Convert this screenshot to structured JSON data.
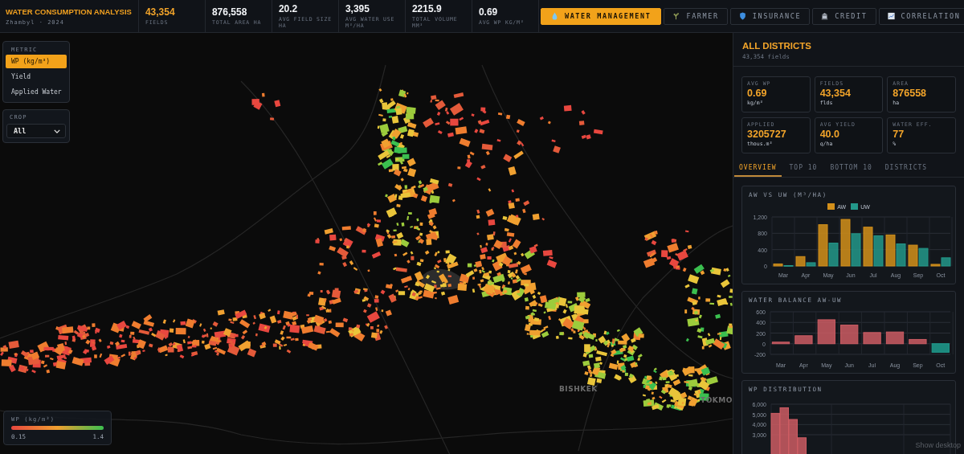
{
  "header": {
    "title": "WATER CONSUMPTION ANALYSIS",
    "subtitle": "Zhambyl · 2024",
    "stats": [
      {
        "value": "43,354",
        "label": "FIELDS",
        "highlight": true
      },
      {
        "value": "876,558",
        "label": "TOTAL AREA HA",
        "highlight": false
      },
      {
        "value": "20.2",
        "label": "AVG FIELD SIZE HA",
        "highlight": false
      },
      {
        "value": "3,395",
        "label": "AVG WATER USE M³/HA",
        "highlight": false
      },
      {
        "value": "2215.9",
        "label": "TOTAL VOLUME MM³",
        "highlight": false
      },
      {
        "value": "0.69",
        "label": "AVG WP KG/M³",
        "highlight": false
      }
    ]
  },
  "nav_tabs": [
    {
      "label": "WATER MANAGEMENT",
      "selected": true
    },
    {
      "label": "FARMER",
      "selected": false
    },
    {
      "label": "INSURANCE",
      "selected": false
    },
    {
      "label": "CREDIT",
      "selected": false
    },
    {
      "label": "CORRELATION",
      "selected": false
    }
  ],
  "map": {
    "metric": {
      "title": "METRIC",
      "options": [
        {
          "label": "WP (kg/m³)",
          "selected": true
        },
        {
          "label": "Yield",
          "selected": false
        },
        {
          "label": "Applied Water",
          "selected": false
        }
      ]
    },
    "crop": {
      "title": "CROP",
      "value": "All"
    },
    "legend": {
      "title": "WP (kg/m³)",
      "min": "0.15",
      "max": "1.4"
    },
    "place_labels": [
      {
        "name": "BISHKEK"
      },
      {
        "name": "TOKMO"
      }
    ]
  },
  "panel": {
    "title": "ALL DISTRICTS",
    "subtitle": "43,354 fields",
    "cards": [
      {
        "label": "AVG WP",
        "value": "0.69",
        "unit": "kg/m³"
      },
      {
        "label": "FIELDS",
        "value": "43,354",
        "unit": "flds"
      },
      {
        "label": "AREA",
        "value": "876558",
        "unit": "ha"
      },
      {
        "label": "APPLIED",
        "value": "3205727",
        "unit": "thous.m³"
      },
      {
        "label": "AVG YIELD",
        "value": "40.0",
        "unit": "q/ha"
      },
      {
        "label": "WATER EFF.",
        "value": "77",
        "unit": "%"
      }
    ],
    "tabs": [
      {
        "label": "OVERVIEW",
        "selected": true
      },
      {
        "label": "TOP 10",
        "selected": false
      },
      {
        "label": "BOTTOM 10",
        "selected": false
      },
      {
        "label": "DISTRICTS",
        "selected": false
      }
    ],
    "charts": [
      {
        "title": "AW VS UW (M³/HA)",
        "chart_data": {
          "type": "bar",
          "grid": true,
          "categories": [
            "Mar",
            "Apr",
            "May",
            "Jun",
            "Jul",
            "Aug",
            "Sep",
            "Oct"
          ],
          "series": [
            {
              "name": "AW",
              "color": "#d4901a",
              "values": [
                50,
                230,
                1010,
                1140,
                950,
                760,
                510,
                40
              ]
            },
            {
              "name": "UW",
              "color": "#23988a",
              "values": [
                10,
                80,
                560,
                790,
                740,
                540,
                430,
                200
              ]
            }
          ],
          "ylim": [
            0,
            1200
          ],
          "yticks": [
            {
              "value": 0,
              "label": "0"
            },
            {
              "value": 400,
              "label": "400"
            },
            {
              "value": 800,
              "label": "800"
            },
            {
              "value": 1200,
              "label": "1,200"
            }
          ]
        }
      },
      {
        "title": "WATER BALANCE AW-UW",
        "chart_data": {
          "type": "bar",
          "grid": true,
          "categories": [
            "Mar",
            "Apr",
            "May",
            "Jun",
            "Jul",
            "Aug",
            "Sep",
            "Oct"
          ],
          "stacked": true,
          "series": [
            {
              "color": "#cd5c63",
              "values": [
                30,
                150,
                450,
                350,
                210,
                220,
                80,
                null
              ]
            },
            {
              "color": "#1f9d8e",
              "values": [
                null,
                null,
                null,
                null,
                null,
                null,
                null,
                -160
              ]
            }
          ],
          "ylim": [
            -200,
            600
          ],
          "yticks": [
            {
              "value": -200,
              "label": "-200"
            },
            {
              "value": 0,
              "label": "0"
            },
            {
              "value": 200,
              "label": "200"
            },
            {
              "value": 400,
              "label": "400"
            },
            {
              "value": 600,
              "label": "600"
            }
          ]
        }
      },
      {
        "title": "WP DISTRIBUTION",
        "chart_data": {
          "type": "bar",
          "grid": true,
          "series": [
            {
              "color": "#cd5c63",
              "values": [
                5100,
                5650,
                4500,
                2700
              ]
            }
          ],
          "ylim": [
            0,
            6000
          ],
          "yticks": [
            {
              "value": 3000,
              "label": "3,000"
            },
            {
              "value": 4000,
              "label": "4,000"
            },
            {
              "value": 5000,
              "label": "5,000"
            },
            {
              "value": 6000,
              "label": "6,000"
            }
          ]
        }
      }
    ]
  },
  "os_tooltip": "Show desktop"
}
